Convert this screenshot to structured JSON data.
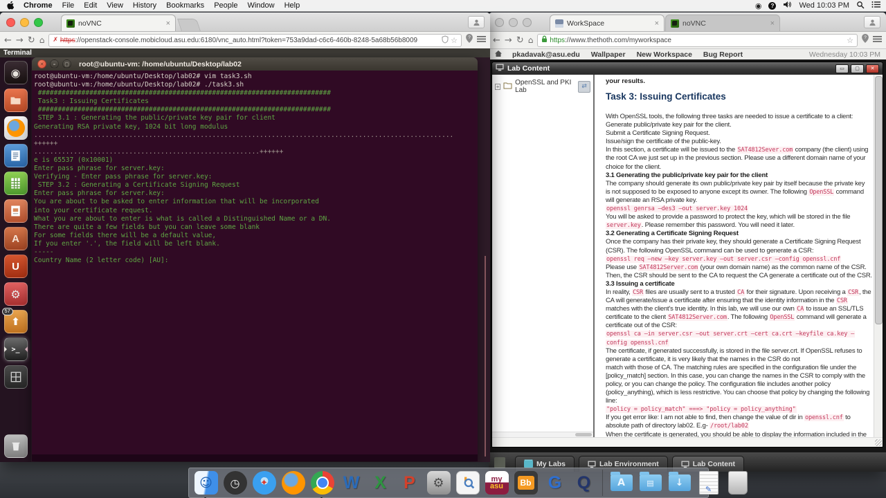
{
  "menubar": {
    "app_menu": "Chrome",
    "items": [
      "File",
      "Edit",
      "View",
      "History",
      "Bookmarks",
      "People",
      "Window",
      "Help"
    ],
    "clock": "Wed 10:03 PM",
    "status_icons": [
      "screen-record-icon",
      "help-icon",
      "volume-icon",
      "spotlight-icon",
      "notification-center-icon"
    ]
  },
  "left_window": {
    "tab_title": "noVNC",
    "url_scheme": "https",
    "url_rest": "://openstack-console.mobicloud.asu.edu:6180/vnc_auto.html?token=753a9dad-c6c6-460b-8248-5a68b56b8009",
    "unity_panel_app": "Terminal",
    "launcher": [
      {
        "name": "dash-home"
      },
      {
        "name": "files"
      },
      {
        "name": "firefox"
      },
      {
        "name": "libreoffice-writer"
      },
      {
        "name": "libreoffice-calc"
      },
      {
        "name": "libreoffice-impress"
      },
      {
        "name": "software-center"
      },
      {
        "name": "ubuntu-one"
      },
      {
        "name": "system-settings"
      },
      {
        "name": "software-updater",
        "badge": "57"
      },
      {
        "name": "terminal",
        "active": true
      },
      {
        "name": "workspace-switcher"
      }
    ],
    "launcher_trash": {
      "name": "trash"
    },
    "terminal": {
      "title": "root@ubuntu-vm: /home/ubuntu/Desktop/lab02",
      "lines": [
        [
          "w",
          "root@ubuntu-vm:/home/ubuntu/Desktop/lab02# vim task3.sh"
        ],
        [
          "w",
          "root@ubuntu-vm:/home/ubuntu/Desktop/lab02# ./task3.sh"
        ],
        [
          "g",
          " ##########################################################################"
        ],
        [
          "g",
          " Task3 : Issuing Certificates"
        ],
        [
          "g",
          " ##########################################################################"
        ],
        [
          "g",
          " STEP 3.1 : Generating the public/private key pair for client"
        ],
        [
          "g",
          "Generating RSA private key, 1024 bit long modulus"
        ],
        [
          "d",
          ".........................................................................................................."
        ],
        [
          "d",
          "++++++"
        ],
        [
          "d",
          ".........................................................++++++"
        ],
        [
          "g",
          "e is 65537 (0x10001)"
        ],
        [
          "g",
          "Enter pass phrase for server.key:"
        ],
        [
          "g",
          "Verifying - Enter pass phrase for server.key:"
        ],
        [
          "g",
          " STEP 3.2 : Generating a Certificate Signing Request"
        ],
        [
          "g",
          "Enter pass phrase for server.key:"
        ],
        [
          "g",
          "You are about to be asked to enter information that will be incorporated"
        ],
        [
          "g",
          "into your certificate request."
        ],
        [
          "g",
          "What you are about to enter is what is called a Distinguished Name or a DN."
        ],
        [
          "g",
          "There are quite a few fields but you can leave some blank"
        ],
        [
          "g",
          "For some fields there will be a default value,"
        ],
        [
          "g",
          "If you enter '.', the field will be left blank."
        ],
        [
          "g",
          "-----"
        ],
        [
          "g",
          "Country Name (2 letter code) [AU]:"
        ]
      ]
    }
  },
  "right_window": {
    "tabs": [
      {
        "title": "WorkSpace",
        "active": true
      },
      {
        "title": "noVNC",
        "active": false
      }
    ],
    "url_scheme": "https",
    "url_rest": "://www.thethoth.com/myworkspace",
    "bookmarks": [
      "pkadavak@asu.edu",
      "Wallpaper",
      "New Workspace",
      "Bug Report"
    ],
    "bookmarks_clock": "Wednesday 10:03 PM",
    "lab_app": {
      "window_title": "Lab Content",
      "tree_item": "OpenSSL and PKI Lab",
      "doc_top_partial": "your results.",
      "doc_title": "Task 3: Issuing Certificates",
      "doc_lines": [
        [
          [
            "n",
            "With OpenSSL tools, the following three tasks are needed to issue a certificate to a client:"
          ]
        ],
        [
          [
            "n",
            "Generate public/private key pair for the client."
          ]
        ],
        [
          [
            "n",
            "Submit a Certificate Signing Request."
          ]
        ],
        [
          [
            "n",
            "Issue/sign the certificate of the public-key."
          ]
        ],
        [
          [
            "n",
            "In this section, a certificate will be issued to the "
          ],
          [
            "c",
            "SAT4812Sever.com"
          ],
          [
            "n",
            " company (the client) using"
          ]
        ],
        [
          [
            "n",
            "the root CA we just set up in the previous section. Please use a different domain name of your"
          ]
        ],
        [
          [
            "n",
            "choice for the client."
          ]
        ],
        [
          [
            "b",
            "3.1 Generating the public/private key pair for the client"
          ]
        ],
        [
          [
            "n",
            "The company should generate its own public/private key pair by itself because the private key"
          ]
        ],
        [
          [
            "n",
            "is not supposed to be exposed to anyone except its owner. The following "
          ],
          [
            "c",
            "OpenSSL"
          ],
          [
            "n",
            " command"
          ]
        ],
        [
          [
            "n",
            "will generate an RSA private key."
          ]
        ],
        [
          [
            "c",
            "openssl genrsa –des3 –out server.key 1024"
          ]
        ],
        [
          [
            "n",
            "You will be asked to provide a password to protect the key, which will be stored in the file"
          ]
        ],
        [
          [
            "c",
            "server.key"
          ],
          [
            "n",
            ". Please remember this password. You will need it later."
          ]
        ],
        [
          [
            "b",
            "3.2 Generating a Certificate Signing Request"
          ]
        ],
        [
          [
            "n",
            "Once the company has their private key, they should generate a Certificate Signing Request"
          ]
        ],
        [
          [
            "n",
            "(CSR). The following OpenSSL command can be used to generate a CSR:"
          ]
        ],
        [
          [
            "c",
            "openssl req –new –key server.key –out server.csr –config openssl.cnf"
          ]
        ],
        [
          [
            "n",
            "Please use "
          ],
          [
            "c",
            "SAT4812Server.com"
          ],
          [
            "n",
            " (your own domain name) as the common name of the CSR."
          ]
        ],
        [
          [
            "n",
            "Then, the CSR should be sent to the CA to request the CA generate a certificate out of the CSR."
          ]
        ],
        [
          [
            "b",
            "3.3 Issuing a certificate"
          ]
        ],
        [
          [
            "n",
            "In reality, "
          ],
          [
            "c",
            "CSR"
          ],
          [
            "n",
            " files are usually sent to a trusted "
          ],
          [
            "c",
            "CA"
          ],
          [
            "n",
            " for their signature. Upon receiving a "
          ],
          [
            "c",
            "CSR"
          ],
          [
            "n",
            ", the"
          ]
        ],
        [
          [
            "n",
            "CA will generate/issue a certificate after ensuring that the identity information in the "
          ],
          [
            "c",
            "CSR"
          ]
        ],
        [
          [
            "n",
            "matches with the client's true identity. In this lab, we will use our own "
          ],
          [
            "c",
            "CA"
          ],
          [
            "n",
            " to issue an SSL/TLS"
          ]
        ],
        [
          [
            "n",
            "certificate to the client "
          ],
          [
            "c",
            "SAT4812Server.com"
          ],
          [
            "n",
            ". The following "
          ],
          [
            "c",
            "OpenSSL"
          ],
          [
            "n",
            " command will generate a"
          ]
        ],
        [
          [
            "n",
            "certificate out of the CSR:"
          ]
        ],
        [
          [
            "c",
            "openssl ca –in server.csr –out server.crt –cert ca.crt –keyfile ca.key –"
          ]
        ],
        [
          [
            "c",
            "config openssl.cnf"
          ]
        ],
        [
          [
            "n",
            "The certificate, if generated successfully, is stored in the file server.crt.  If OpenSSL refuses to"
          ]
        ],
        [
          [
            "n",
            "generate a certificate, it is very likely that the names in the CSR do not"
          ]
        ],
        [
          [
            "n",
            "match with those of CA. The matching rules are specified in the configuration file under the"
          ]
        ],
        [
          [
            "n",
            "[policy_match] section. In this case, you can change the names in the CSR to comply with the"
          ]
        ],
        [
          [
            "n",
            "policy, or you can change the policy. The configuration file includes another policy"
          ]
        ],
        [
          [
            "n",
            "(policy_anything), which is less restrictive. You can choose that policy by changing the following"
          ]
        ],
        [
          [
            "n",
            "line:"
          ]
        ],
        [
          [
            "c",
            "\"policy = policy_match\" ===> \"policy = policy_anything\""
          ]
        ],
        [
          [
            "n",
            "If you get error like: I am not able to find, then change the value of dir in "
          ],
          [
            "c",
            "openssl.cnf"
          ],
          [
            "n",
            " to"
          ]
        ],
        [
          [
            "n",
            "absolute path of directory lab02. E.g- "
          ],
          [
            "c",
            "/root/lab02"
          ]
        ],
        [
          [
            "n",
            "When the certificate is generated, you should be able to display the information included in the"
          ]
        ]
      ],
      "taskbar": [
        {
          "icon": "folder",
          "label": "My Labs",
          "active": false
        },
        {
          "icon": "monitor",
          "label": "Lab Environment",
          "active": false
        },
        {
          "icon": "monitor",
          "label": "Lab Content",
          "active": true
        }
      ]
    }
  },
  "dock": {
    "items": [
      {
        "name": "finder",
        "dot": true
      },
      {
        "name": "activity-monitor",
        "dot": false
      },
      {
        "name": "safari",
        "dot": false
      },
      {
        "name": "firefox",
        "dot": false
      },
      {
        "name": "chrome",
        "dot": true
      },
      {
        "name": "word",
        "dot": false
      },
      {
        "name": "excel",
        "dot": false
      },
      {
        "name": "powerpoint",
        "dot": false
      },
      {
        "name": "system-preferences",
        "dot": false
      },
      {
        "name": "search-app",
        "dot": false
      },
      {
        "name": "myasu",
        "dot": false
      },
      {
        "name": "blackboard",
        "dot": false
      },
      {
        "name": "g-app",
        "dot": false
      },
      {
        "name": "quicktime",
        "dot": false
      },
      {
        "name": "separator",
        "dot": false
      },
      {
        "name": "applications-folder",
        "dot": false
      },
      {
        "name": "documents-folder",
        "dot": false
      },
      {
        "name": "downloads-folder",
        "dot": false
      },
      {
        "name": "textedit-document",
        "dot": false
      },
      {
        "name": "trash",
        "dot": false
      }
    ]
  }
}
